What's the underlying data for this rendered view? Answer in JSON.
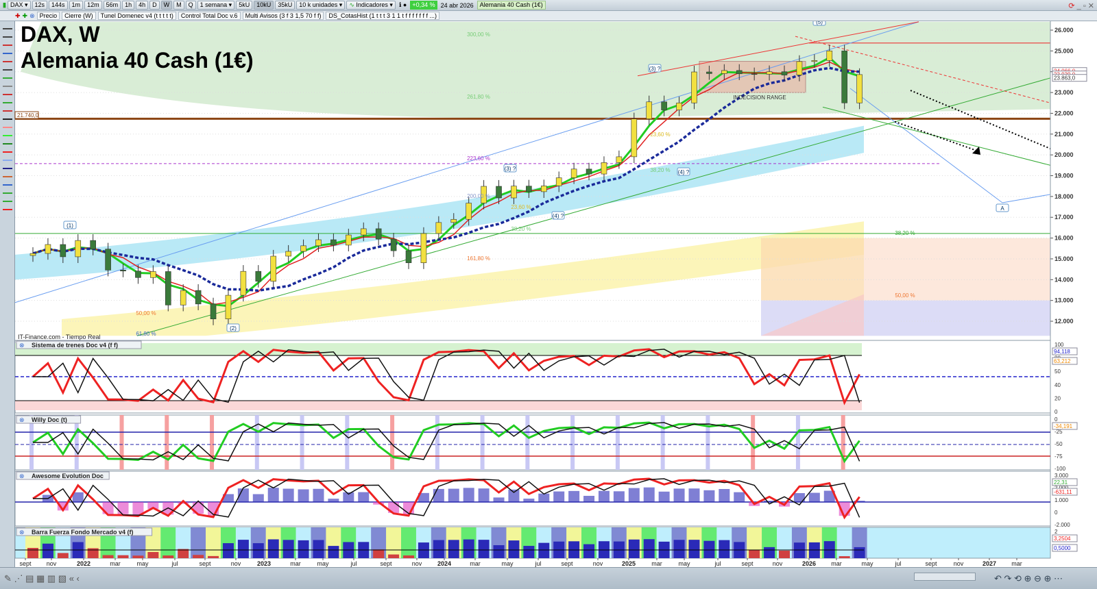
{
  "toolbar": {
    "symbol": "DAX",
    "timeframes": [
      "12s",
      "144s",
      "1m",
      "12m",
      "56m",
      "1h",
      "4h",
      "D",
      "W",
      "M",
      "Q"
    ],
    "active_timeframe": "W",
    "period": "1 semana",
    "units": [
      "5kU",
      "10kU",
      "35kU"
    ],
    "active_unit": "10kU",
    "units_select": "10 k unidades",
    "indicators_label": "Indicadores",
    "change_pct": "+0,34 %",
    "date": "24 abr 2026",
    "instrument": "Alemania 40 Cash (1€)"
  },
  "indicator_bar": [
    "Precio",
    "Cierre (W)",
    "Tunel Domenec v4 (t t t t t)",
    "Control Total Doc v.6",
    "Multi Avisos (3 f 3 1,5 70 f f)",
    "DS_CotasHist (1 t t t 3 1 1 t f f f f f f f ...)"
  ],
  "title": {
    "line1": "DAX, W",
    "line2": "Alemania 40 Cash (1€)"
  },
  "source": "IT-Finance.com - Tiempo Real",
  "panels": {
    "sistema": {
      "label": "Sistema de trenes Doc v4 (f f)",
      "axis": [
        "100",
        "80",
        "50",
        "40",
        "20",
        "0"
      ],
      "tags": [
        "94,118",
        "63,212"
      ]
    },
    "willy": {
      "label": "Willy Doc (t)",
      "axis": [
        "0",
        "-25",
        "-50",
        "-75",
        "-100"
      ],
      "tags": [
        "-34,191"
      ]
    },
    "awesome": {
      "label": "Awesome Evolution Doc",
      "axis": [
        "3.000",
        "2.000",
        "1.000",
        "0",
        "-2.000"
      ],
      "tags": [
        "22,31",
        "-631,11"
      ]
    },
    "barra": {
      "label": "Barra Fuerza Fondo Mercado v4 (f)",
      "axis": [
        "2"
      ],
      "tags": [
        "3,2504",
        "0,5000"
      ]
    }
  },
  "price_tags": [
    "24.066,0",
    "23.939,0",
    "23.863,0"
  ],
  "level_tag": "21.740,0",
  "annotations": {
    "fibs": [
      "300,00 %",
      "261,80 %",
      "223,60 %",
      "200,00 %",
      "161,80 %",
      "50,00 %",
      "61,80 %",
      "38,20 %",
      "23,60 %",
      "23,60 %",
      "38,20 %",
      "38,20 %",
      "50,00 %"
    ],
    "waves": [
      "(1)",
      "(2)",
      "(3) ?",
      "(4) ?",
      "(3) ?",
      "(4) ?",
      "(5)",
      "5",
      "A"
    ],
    "range": "INDECISION RANGE"
  },
  "chart_data": {
    "type": "candlestick",
    "title": "DAX, W",
    "x_start": "2021-09",
    "interval": "month",
    "closes": [
      15260,
      15690,
      15100,
      15885,
      15470,
      14460,
      14415,
      14100,
      14390,
      12780,
      13480,
      12830,
      12110,
      13250,
      14400,
      13920,
      15130,
      15360,
      15630,
      15920,
      15660,
      16150,
      16450,
      15950,
      15390,
      14810,
      16220,
      16750,
      16900,
      17680,
      18490,
      17930,
      18500,
      18230,
      18510,
      18900,
      19320,
      19080,
      19630,
      19910,
      21730,
      22550,
      22160,
      22500,
      23990,
      23910,
      24060,
      23900,
      23880,
      24000,
      23840,
      24490,
      24540,
      25000,
      22500,
      23863
    ],
    "y_ticks": [
      "26.000",
      "25.000",
      "24.000",
      "23.000",
      "22.000",
      "21.000",
      "20.000",
      "19.000",
      "18.000",
      "17.000",
      "16.000",
      "15.000",
      "14.000",
      "13.000",
      "12.000"
    ],
    "ylim": [
      11300,
      26400
    ],
    "x_ticks": [
      "sept",
      "nov",
      "2022",
      "mar",
      "may",
      "jul",
      "sept",
      "nov",
      "2023",
      "mar",
      "may",
      "jul",
      "sept",
      "nov",
      "2024",
      "mar",
      "may",
      "jul",
      "sept",
      "nov",
      "2025",
      "mar",
      "may",
      "jul",
      "sept",
      "nov",
      "2026",
      "mar",
      "may",
      "jul",
      "sept",
      "nov",
      "2027",
      "mar"
    ]
  },
  "colors": {
    "up": "#2e9e2e",
    "down": "#d02020",
    "ma_fast": "#22cc22",
    "ma_mid": "#e02020",
    "ma_slow": "#1a2a9a",
    "level": "#8b4513"
  }
}
